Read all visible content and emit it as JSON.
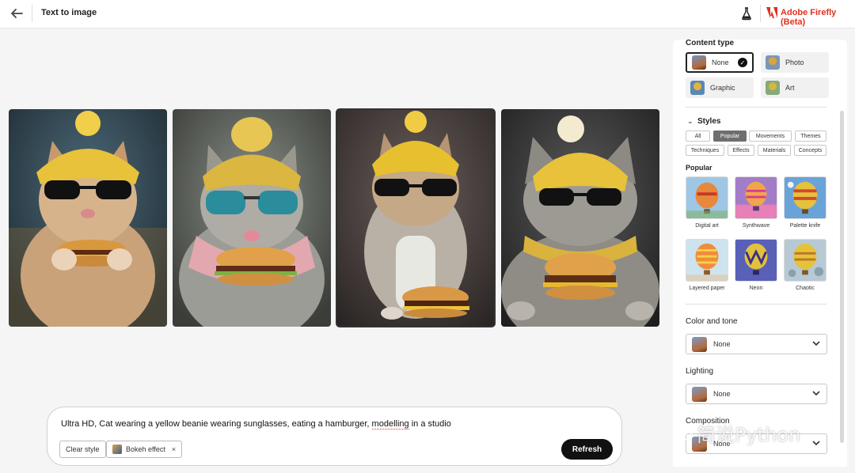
{
  "header": {
    "title": "Text to image",
    "brand": "Adobe Firefly (Beta)"
  },
  "colors": {
    "accent": "#e0311f",
    "dark": "#111111"
  },
  "images": [
    {
      "alt": "cat-image-1",
      "selected": false
    },
    {
      "alt": "cat-image-2",
      "selected": false
    },
    {
      "alt": "cat-image-3",
      "selected": true
    },
    {
      "alt": "cat-image-4",
      "selected": false
    }
  ],
  "prompt": {
    "text_before": "Ultra HD, Cat wearing a yellow beanie wearing sunglasses, eating a hamburger, ",
    "text_flagged": "modelling",
    "text_after": " in a studio",
    "clear_style": "Clear style",
    "tag": "Bokeh effect",
    "tag_remove": "×",
    "refresh": "Refresh"
  },
  "panel": {
    "content_type_title": "Content type",
    "content_types": [
      "None",
      "Photo",
      "Graphic",
      "Art"
    ],
    "styles_title": "Styles",
    "style_tabs": [
      "All",
      "Popular",
      "Movements",
      "Themes",
      "Techniques",
      "Effects",
      "Materials",
      "Concepts"
    ],
    "popular_title": "Popular",
    "popular_styles": [
      "Digital art",
      "Synthwave",
      "Palette knife",
      "Layered paper",
      "Neon",
      "Chaotic"
    ],
    "color_tone_title": "Color and tone",
    "color_tone_value": "None",
    "lighting_title": "Lighting",
    "lighting_value": "None",
    "composition_title": "Composition",
    "composition_value": "None"
  },
  "watermark": "简说Python"
}
